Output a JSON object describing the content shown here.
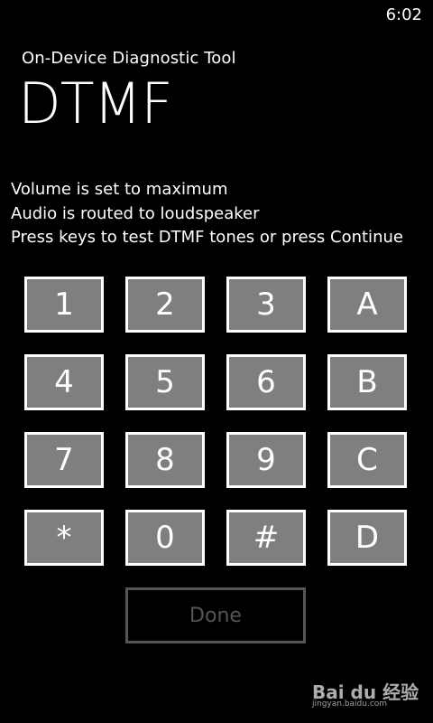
{
  "status_bar": {
    "time": "6:02"
  },
  "header": {
    "app_title": "On-Device Diagnostic Tool",
    "page_title": "DTMF"
  },
  "instructions": [
    "Volume is set to maximum",
    "Audio is routed to loudspeaker",
    "Press keys to test DTMF tones or press Continue"
  ],
  "keypad": {
    "keys": [
      "1",
      "2",
      "3",
      "A",
      "4",
      "5",
      "6",
      "B",
      "7",
      "8",
      "9",
      "C",
      "*",
      "0",
      "#",
      "D"
    ]
  },
  "done_button": {
    "label": "Done",
    "enabled": false
  },
  "watermark": {
    "logo_text": "Bai du 经验",
    "url": "jingyan.baidu.com"
  },
  "colors": {
    "background": "#000000",
    "key_fill": "#7f7f7f",
    "key_border": "#ffffff",
    "disabled": "#555555"
  }
}
